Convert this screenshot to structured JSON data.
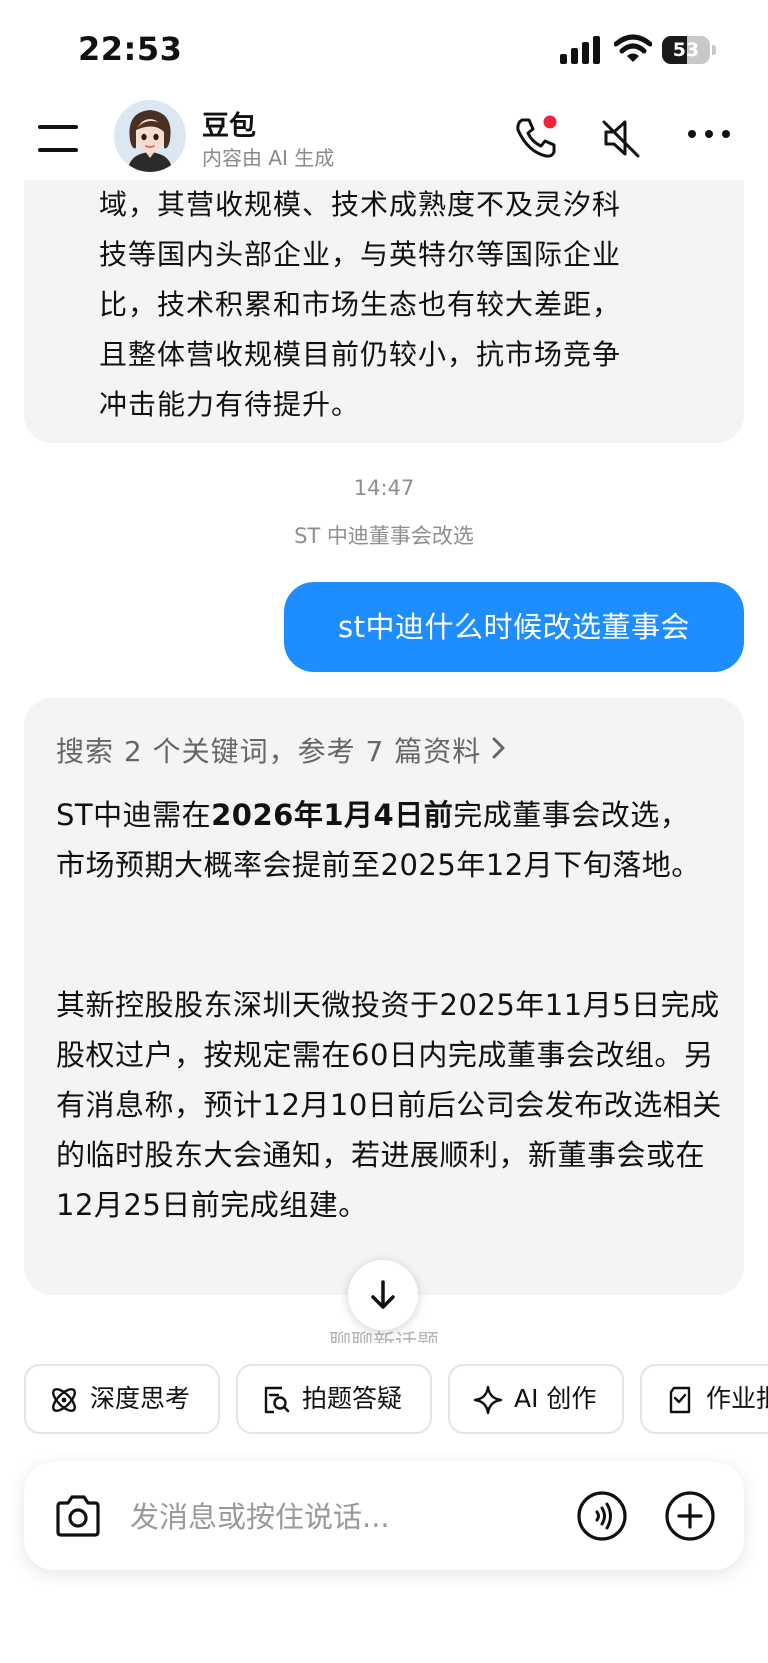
{
  "status_bar": {
    "time": "22:53",
    "battery": "53",
    "battery_level": 0.53
  },
  "header": {
    "bot_name": "豆包",
    "subtitle": "内容由 AI 生成"
  },
  "messages": {
    "ai_prev_lines": [
      "域，其营收规模、技术成熟度不及灵汐科",
      "技等国内头部企业，与英特尔等国际企业",
      "比，技术积累和市场生态也有较大差距，",
      "且整体营收规模目前仍较小，抗市场竞争",
      "冲击能力有待提升。"
    ],
    "timestamp": "14:47",
    "topic": "ST 中迪董事会改选",
    "user_message": "st中迪什么时候改选董事会",
    "search_summary": "搜索 2 个关键词，参考 7 篇资料",
    "answer_p1_a": "ST中迪需在",
    "answer_p1_bold": "2026年1月4日前",
    "answer_p1_b": "完成董事会改选，市场预期大概率会提前至2025年12月下旬落地。",
    "answer_p2": "其新控股股东深圳天微投资于2025年11月5日完成股权过户，按规定需在60日内完成董事会改组。另有消息称，预计12月10日前后公司会发布改选相关的临时股东大会通知，若进展顺利，新董事会或在12月25日前完成组建。"
  },
  "new_topic_hint": "聊聊新话题",
  "quick_actions": [
    {
      "label": "深度思考",
      "icon": "atom-icon"
    },
    {
      "label": "拍题答疑",
      "icon": "photo-search-icon"
    },
    {
      "label": "AI 创作",
      "icon": "sparkle-icon"
    },
    {
      "label": "作业批改",
      "icon": "homework-icon"
    }
  ],
  "composer": {
    "placeholder": "发消息或按住说话..."
  },
  "colors": {
    "accent": "#1e8dff",
    "ai_bubble": "#f4f4f6",
    "notification_dot": "#f0243b"
  }
}
